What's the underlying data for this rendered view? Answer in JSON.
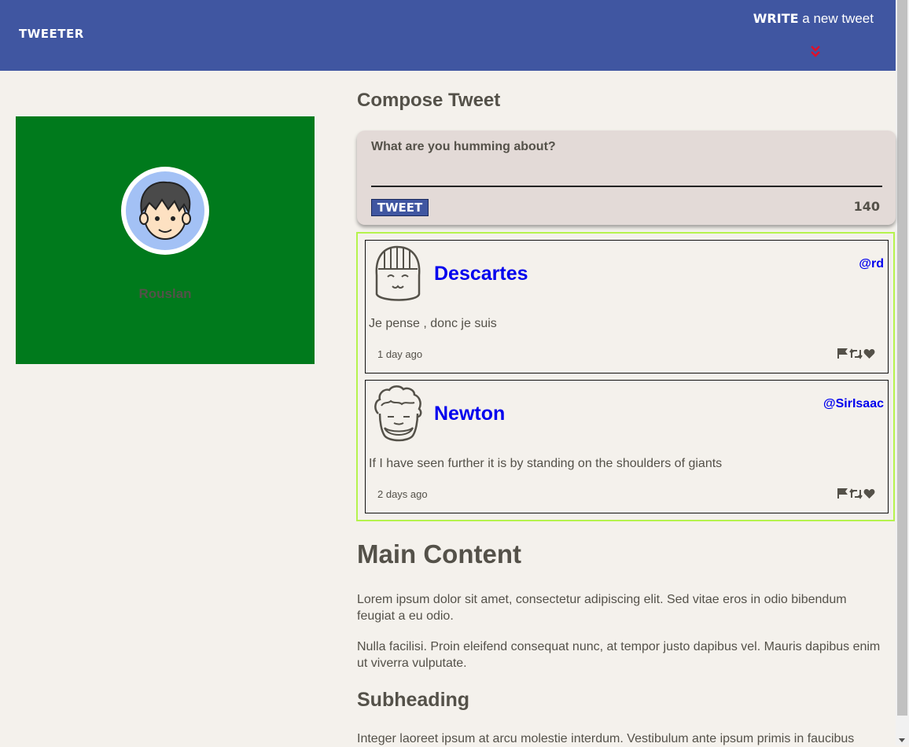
{
  "nav": {
    "brand": "TWEETER",
    "write_strong": "WRITE",
    "write_rest": " a new tweet"
  },
  "profile": {
    "name": "Rouslan"
  },
  "compose": {
    "title": "Compose Tweet",
    "label": "What are you humming about?",
    "value": "",
    "button": "TWEET",
    "counter": "140"
  },
  "tweets": [
    {
      "name": "Descartes",
      "handle": "@rd",
      "text": "Je pense , donc je suis",
      "time": "1 day ago"
    },
    {
      "name": "Newton",
      "handle": "@SirIsaac",
      "text": "If I have seen further it is by standing on the shoulders of giants",
      "time": "2 days ago"
    }
  ],
  "content": {
    "heading": "Main Content",
    "para1": "Lorem ipsum dolor sit amet, consectetur adipiscing elit. Sed vitae eros in odio bibendum feugiat a eu odio.",
    "para2": "Nulla facilisi. Proin eleifend consequat nunc, at tempor justo dapibus vel. Mauris dapibus enim ut viverra vulputate.",
    "subheading": "Subheading",
    "para3": "Integer laoreet ipsum at arcu molestie interdum. Vestibulum ante ipsum primis in faucibus"
  },
  "colors": {
    "nav": "#4056a1",
    "profile_bg": "#007a1c",
    "tweets_border": "#b5f34d",
    "link": "#0000ee",
    "chevron": "#f13c20"
  },
  "icons": [
    "chevron-double-down-icon",
    "flag-icon",
    "retweet-icon",
    "heart-icon"
  ]
}
